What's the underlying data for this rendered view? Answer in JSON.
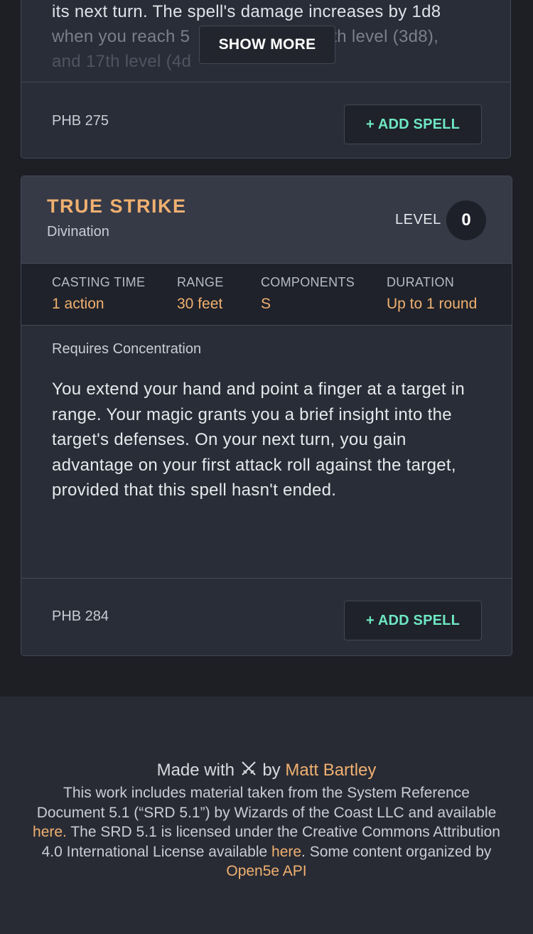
{
  "prev_card": {
    "description_line1": "its next turn. The spell's damage increases by 1d8",
    "description_line2a": "when you reach 5",
    "description_line2b": "th level (3d8),",
    "description_line3": "and 17th level (4d",
    "show_more_label": "SHOW MORE",
    "source": "PHB 275",
    "add_spell_label": "+ ADD SPELL"
  },
  "spell": {
    "name": "TRUE STRIKE",
    "school": "Divination",
    "level_label": "LEVEL",
    "level_value": "0",
    "stats": {
      "casting_time_label": "CASTING TIME",
      "casting_time_value": "1 action",
      "range_label": "RANGE",
      "range_value": "30 feet",
      "components_label": "COMPONENTS",
      "components_value": "S",
      "duration_label": "DURATION",
      "duration_value": "Up to 1 round"
    },
    "concentration": "Requires Concentration",
    "description": "You extend your hand and point a finger at a target in range. Your magic grants you a brief insight into the target's defenses. On your next turn, you gain advantage on your first attack roll against the target, provided that this spell hasn't ended.",
    "source": "PHB 284",
    "add_spell_label": "+ ADD SPELL"
  },
  "footer": {
    "made_with": "Made with",
    "made_icon": "crossed-swords-icon",
    "by": "by",
    "author": "Matt Bartley",
    "license_part1": "This work includes material taken from the System Reference Document 5.1 (“SRD 5.1”) by Wizards of the Coast LLC and available",
    "here_link_1": "here.",
    "license_part2": "The SRD 5.1 is licensed under the Creative Commons Attribution 4.0 International License available",
    "here_link_2": "here",
    "license_part3": ". Some content organized by",
    "api_link": "Open5e API"
  },
  "colors": {
    "accent_orange": "#f0b070",
    "accent_teal": "#6ee7c2",
    "background": "#1d1f25",
    "card": "#292d37"
  }
}
